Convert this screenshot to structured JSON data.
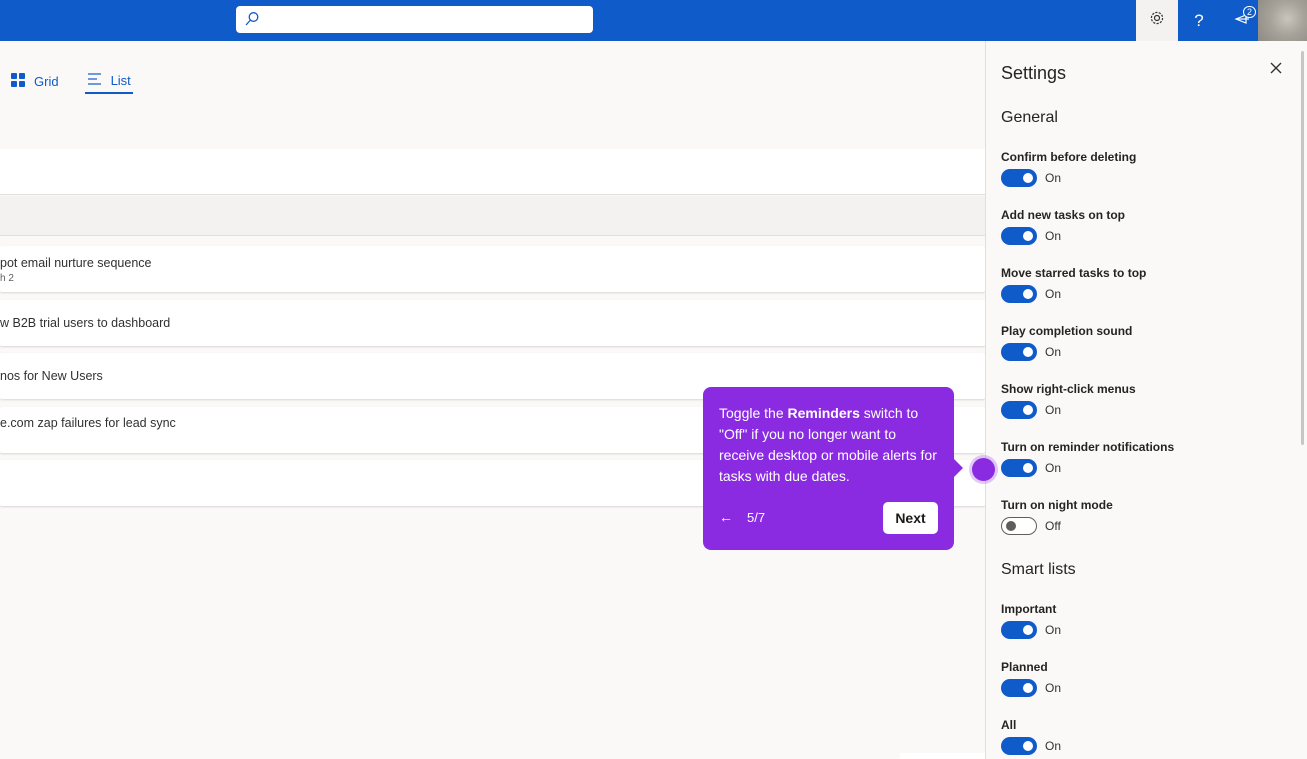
{
  "search": {
    "placeholder": ""
  },
  "topbar": {
    "notification_count": "2",
    "help_label": "?"
  },
  "view": {
    "grid_label": "Grid",
    "list_label": "List"
  },
  "tasks": [
    {
      "title": "pot email nurture sequence",
      "subtitle": "h 2"
    },
    {
      "title": "w B2B trial users to dashboard",
      "subtitle": ""
    },
    {
      "title": "nos for New Users",
      "subtitle": ""
    },
    {
      "title": "e.com zap failures for lead sync",
      "subtitle": ""
    }
  ],
  "settings": {
    "title": "Settings",
    "general_heading": "General",
    "general": [
      {
        "label": "Confirm before deleting",
        "state": "On"
      },
      {
        "label": "Add new tasks on top",
        "state": "On"
      },
      {
        "label": "Move starred tasks to top",
        "state": "On"
      },
      {
        "label": "Play completion sound",
        "state": "On"
      },
      {
        "label": "Show right-click menus",
        "state": "On"
      },
      {
        "label": "Turn on reminder notifications",
        "state": "On"
      },
      {
        "label": "Turn on night mode",
        "state": "Off"
      }
    ],
    "smart_heading": "Smart lists",
    "smart": [
      {
        "label": "Important",
        "state": "On"
      },
      {
        "label": "Planned",
        "state": "On"
      },
      {
        "label": "All",
        "state": "On"
      }
    ]
  },
  "tooltip": {
    "text_pre": "Toggle the ",
    "text_bold": "Reminders",
    "text_post": " switch to \"Off\" if you no longer want to receive desktop or mobile alerts for tasks with due dates.",
    "back": "←",
    "step": "5/7",
    "next": "Next"
  },
  "colors": {
    "brand": "#0f5bc9",
    "guide": "#8a2be2"
  }
}
